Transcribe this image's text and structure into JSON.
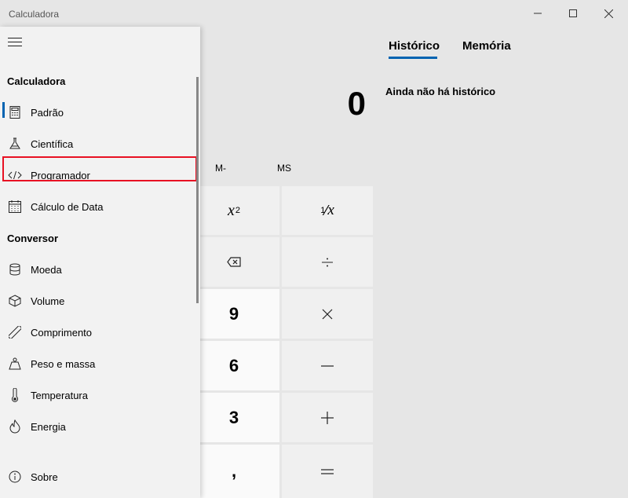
{
  "window": {
    "title": "Calculadora"
  },
  "display": {
    "value": "0"
  },
  "memory": {
    "mminus": "M-",
    "ms": "MS"
  },
  "keys": {
    "square_base": "x",
    "square_exp": "2",
    "reciprocal_num": "1",
    "reciprocal_den": "x",
    "nine": "9",
    "six": "6",
    "three": "3",
    "decimal": ","
  },
  "history": {
    "tab_history": "Histórico",
    "tab_memory": "Memória",
    "empty": "Ainda não há histórico"
  },
  "nav": {
    "section_calc": "Calculadora",
    "section_conv": "Conversor",
    "calc_items": [
      {
        "label": "Padrão",
        "icon": "calculator-icon"
      },
      {
        "label": "Científica",
        "icon": "flask-icon"
      },
      {
        "label": "Programador",
        "icon": "code-icon"
      },
      {
        "label": "Cálculo de Data",
        "icon": "calendar-icon"
      }
    ],
    "conv_items": [
      {
        "label": "Moeda",
        "icon": "coins-icon"
      },
      {
        "label": "Volume",
        "icon": "cube-icon"
      },
      {
        "label": "Comprimento",
        "icon": "ruler-icon"
      },
      {
        "label": "Peso e massa",
        "icon": "weight-icon"
      },
      {
        "label": "Temperatura",
        "icon": "thermometer-icon"
      },
      {
        "label": "Energia",
        "icon": "flame-icon"
      }
    ],
    "about": {
      "label": "Sobre",
      "icon": "info-icon"
    }
  },
  "colors": {
    "accent": "#0063b1",
    "highlight": "#e81123"
  }
}
